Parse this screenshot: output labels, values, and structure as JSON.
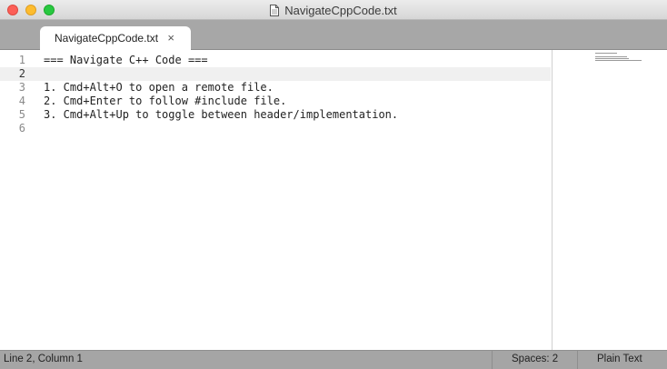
{
  "window": {
    "title": "NavigateCppCode.txt"
  },
  "tabs": [
    {
      "label": "NavigateCppCode.txt",
      "close_glyph": "×",
      "active": true
    }
  ],
  "editor": {
    "line_numbers": [
      "1",
      "2",
      "3",
      "4",
      "5",
      "6"
    ],
    "current_line": 2,
    "lines": [
      "=== Navigate C++ Code ===",
      "",
      "1. Cmd+Alt+O to open a remote file.",
      "2. Cmd+Enter to follow #include file.",
      "3. Cmd+Alt+Up to toggle between header/implementation.",
      ""
    ]
  },
  "status": {
    "position": "Line 2, Column 1",
    "spaces": "Spaces: 2",
    "syntax": "Plain Text"
  },
  "colors": {
    "close": "#fc5f57",
    "minimize": "#fdbc2e",
    "maximize": "#28c840"
  },
  "icons": {
    "title": "document-icon",
    "tab_close": "close-icon"
  }
}
